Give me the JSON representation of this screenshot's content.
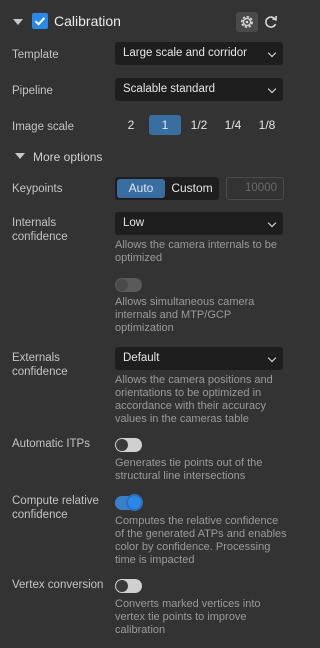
{
  "header": {
    "title": "Calibration",
    "checked": true
  },
  "template": {
    "label": "Template",
    "value": "Large scale and corridor"
  },
  "pipeline": {
    "label": "Pipeline",
    "value": "Scalable standard"
  },
  "image_scale": {
    "label": "Image scale",
    "options": [
      "2",
      "1",
      "1/2",
      "1/4",
      "1/8"
    ],
    "selected": "1"
  },
  "more_options": {
    "label": "More options"
  },
  "keypoints": {
    "label": "Keypoints",
    "auto_label": "Auto",
    "custom_label": "Custom",
    "selected": "Auto",
    "value_placeholder": "10000"
  },
  "internals": {
    "label": "Internals confidence",
    "value": "Low",
    "description": "Allows the camera internals to be optimized"
  },
  "simultaneous": {
    "enabled": false,
    "description": "Allows simultaneous camera internals and MTP/GCP optimization"
  },
  "externals": {
    "label": "Externals confidence",
    "value": "Default",
    "description": "Allows the camera positions and orientations to be optimized in accordance with their accuracy values in the cameras table"
  },
  "automatic_itps": {
    "label": "Automatic ITPs",
    "enabled": false,
    "description": "Generates tie points out of the structural line intersections"
  },
  "relative_confidence": {
    "label": "Compute relative confidence",
    "enabled": true,
    "description": "Computes the relative confidence of the generated ATPs and enables color by confidence. Processing time is impacted"
  },
  "vertex_conversion": {
    "label": "Vertex conversion",
    "enabled": false,
    "description": "Converts marked vertices into vertex tie points to improve calibration"
  },
  "colors": {
    "background": "#333333",
    "field": "#1e1e1e",
    "accent": "#2a88e8",
    "segment_active": "#3a6da0"
  }
}
